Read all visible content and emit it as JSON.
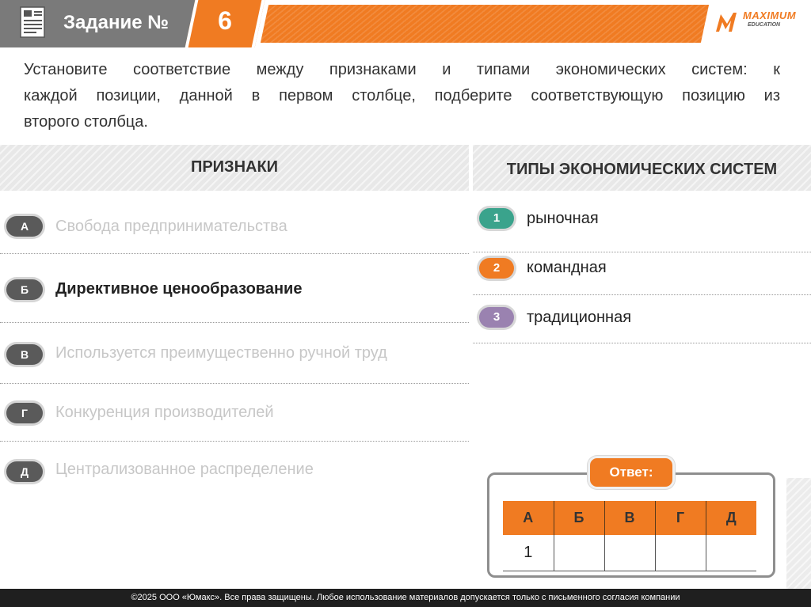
{
  "header": {
    "title": "Задание №",
    "number": "6",
    "logo_text": "MAXIMUM",
    "logo_sub": "EDUCATION",
    "accent": "#f07b22"
  },
  "question": {
    "lines": [
      "Установите соответствие между признаками и типами экономических систем: к",
      "каждой позиции, данной в первом столбце, подберите соответствующую позицию из",
      "второго столбца."
    ]
  },
  "columns": {
    "left_title": "ПРИЗНАКИ",
    "right_title": "ТИПЫ ЭКОНОМИЧЕСКИХ СИСТЕМ"
  },
  "features": [
    {
      "letter": "А",
      "text": "Свобода предпринимательства",
      "state": "faded"
    },
    {
      "letter": "Б",
      "text": "Директивное ценообразование",
      "state": "active"
    },
    {
      "letter": "В",
      "text": "Используется преимущественно ручной труд",
      "state": "faded"
    },
    {
      "letter": "Г",
      "text": "Конкуренция производителей",
      "state": "faded"
    },
    {
      "letter": "Д",
      "text": "Централизованное распределение",
      "state": "faded"
    }
  ],
  "types": [
    {
      "num": "1",
      "text": "рыночная",
      "color": "#3aa38c"
    },
    {
      "num": "2",
      "text": "командная",
      "color": "#f07b22"
    },
    {
      "num": "3",
      "text": "традиционная",
      "color": "#9a82b0"
    }
  ],
  "answer": {
    "label": "Ответ:",
    "headers": [
      "А",
      "Б",
      "В",
      "Г",
      "Д"
    ],
    "values": [
      "1",
      "",
      "",
      "",
      ""
    ]
  },
  "footer": {
    "text": "©2025 ООО «Юмакс». Все права защищены. Любое использование материалов допускается только с письменного согласия компании"
  }
}
